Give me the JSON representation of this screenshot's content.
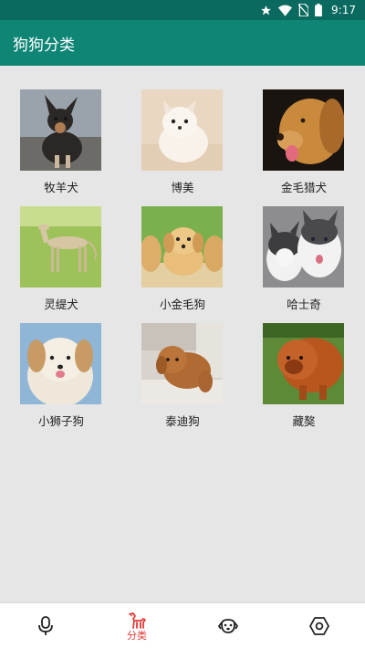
{
  "status_bar": {
    "time": "9:17",
    "icons": [
      "star-icon",
      "wifi-icon",
      "no-sim-icon",
      "battery-icon"
    ]
  },
  "app_bar": {
    "title": "狗狗分类"
  },
  "breeds": [
    {
      "name": "牧羊犬",
      "image": "shepherd-dog-photo"
    },
    {
      "name": "博美",
      "image": "pomeranian-photo"
    },
    {
      "name": "金毛猎犬",
      "image": "golden-retriever-photo"
    },
    {
      "name": "灵缇犬",
      "image": "greyhound-photo"
    },
    {
      "name": "小金毛狗",
      "image": "golden-puppies-photo"
    },
    {
      "name": "哈士奇",
      "image": "husky-photo"
    },
    {
      "name": "小狮子狗",
      "image": "little-lion-dog-photo"
    },
    {
      "name": "泰迪狗",
      "image": "teddy-dog-photo"
    },
    {
      "name": "藏獒",
      "image": "tibetan-mastiff-photo"
    }
  ],
  "bottom_nav": {
    "items": [
      {
        "icon": "microphone-icon",
        "label": ""
      },
      {
        "icon": "dog-icon",
        "label": "分类",
        "active": true
      },
      {
        "icon": "dog-face-icon",
        "label": ""
      },
      {
        "icon": "settings-hexagon-icon",
        "label": ""
      }
    ],
    "active_color": "#e53935",
    "inactive_color": "#222222"
  },
  "colors": {
    "status_bar": "#0b6a5f",
    "app_bar": "#0f8576",
    "background": "#e6e6e6"
  }
}
